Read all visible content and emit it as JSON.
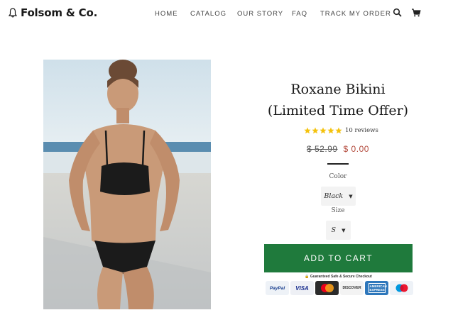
{
  "header": {
    "logo_text": "Folsom & Co.",
    "nav": [
      {
        "label": "HOME"
      },
      {
        "label": "CATALOG"
      },
      {
        "label": "OUR STORY"
      },
      {
        "label": "FAQ"
      },
      {
        "label": "TRACK MY ORDER"
      }
    ],
    "icons": [
      "search-icon",
      "cart-icon"
    ]
  },
  "product": {
    "title_line1": "Roxane Bikini",
    "title_line2": "(Limited Time Offer)",
    "rating_stars": 5,
    "reviews": "10 reviews",
    "old_price": "$ 52.99",
    "new_price": "$ 0.00",
    "color_label": "Color",
    "color_value": "Black",
    "size_label": "Size",
    "size_value": "S",
    "add_to_cart": "ADD TO CART",
    "secure_text": "Guaranteed Safe & Secure Checkout",
    "payments": [
      {
        "name": "paypal",
        "label": "PayPal"
      },
      {
        "name": "visa",
        "label": "VISA"
      },
      {
        "name": "mastercard",
        "label": ""
      },
      {
        "name": "discover",
        "label": "DISCOVER"
      },
      {
        "name": "amex",
        "label": "AMERICAN EXPRESS"
      },
      {
        "name": "maestro",
        "label": ""
      }
    ]
  },
  "colors": {
    "button": "#1f7a3c",
    "sale_price": "#b34a3c",
    "star": "#f4c20d"
  }
}
